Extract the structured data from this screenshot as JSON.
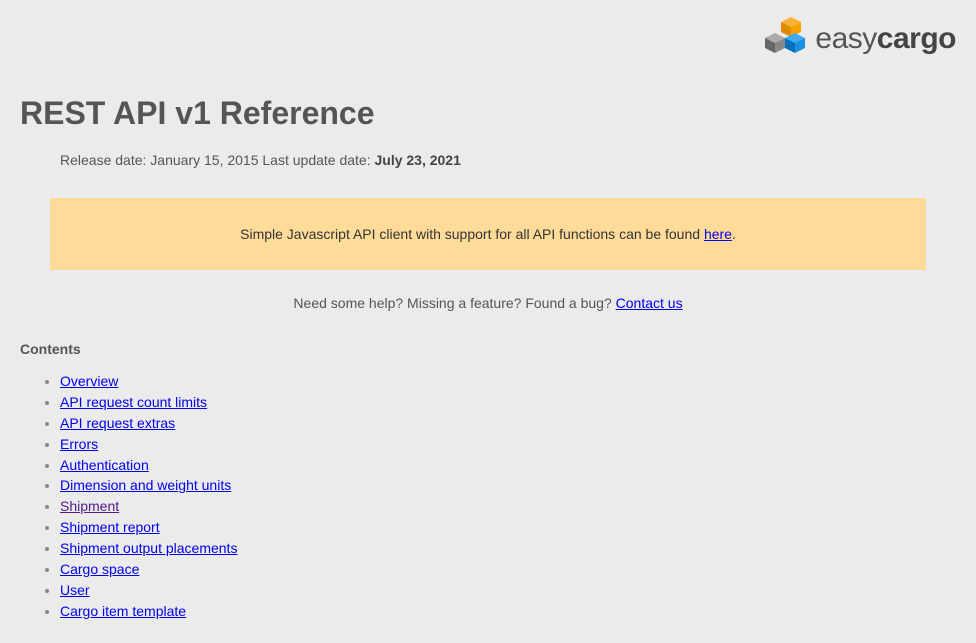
{
  "logo": {
    "text_light": "easy",
    "text_bold": "cargo"
  },
  "title": "REST API v1 Reference",
  "meta": {
    "release_label": "Release date: ",
    "release_date": "January 15, 2015",
    "update_label": " Last update date: ",
    "update_date": "July 23, 2021"
  },
  "banner": {
    "text_before": "Simple Javascript API client with support for all API functions can be found ",
    "link_text": "here",
    "text_after": "."
  },
  "help": {
    "text": "Need some help? Missing a feature? Found a bug? ",
    "link_text": "Contact us"
  },
  "contents_heading": "Contents",
  "toc": [
    "Overview",
    "API request count limits",
    "API request extras",
    "Errors",
    "Authentication",
    "Dimension and weight units",
    "Shipment",
    "Shipment report",
    "Shipment output placements",
    "Cargo space",
    "User",
    "Cargo item template"
  ]
}
